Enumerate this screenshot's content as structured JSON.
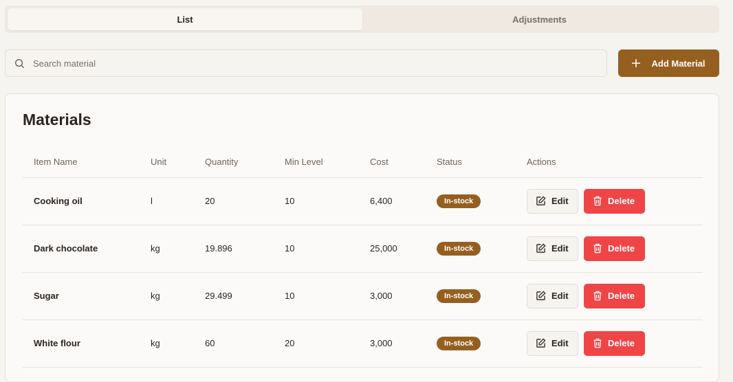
{
  "tabs": [
    {
      "label": "List",
      "active": true
    },
    {
      "label": "Adjustments",
      "active": false
    }
  ],
  "search": {
    "placeholder": "Search material",
    "value": ""
  },
  "add_button": "Add Material",
  "colors": {
    "accent": "#955f20",
    "danger": "#ef4546",
    "background": "#f6f4f0"
  },
  "card": {
    "title": "Materials"
  },
  "table": {
    "headers": [
      "Item Name",
      "Unit",
      "Quantity",
      "Min Level",
      "Cost",
      "Status",
      "Actions"
    ],
    "rows": [
      {
        "name": "Cooking oil",
        "unit": "l",
        "quantity": "20",
        "min": "10",
        "cost": "6,400",
        "status": "In-stock"
      },
      {
        "name": "Dark chocolate",
        "unit": "kg",
        "quantity": "19.896",
        "min": "10",
        "cost": "25,000",
        "status": "In-stock"
      },
      {
        "name": "Sugar",
        "unit": "kg",
        "quantity": "29.499",
        "min": "10",
        "cost": "3,000",
        "status": "In-stock"
      },
      {
        "name": "White flour",
        "unit": "kg",
        "quantity": "60",
        "min": "20",
        "cost": "3,000",
        "status": "In-stock"
      }
    ],
    "edit_label": "Edit",
    "delete_label": "Delete"
  }
}
